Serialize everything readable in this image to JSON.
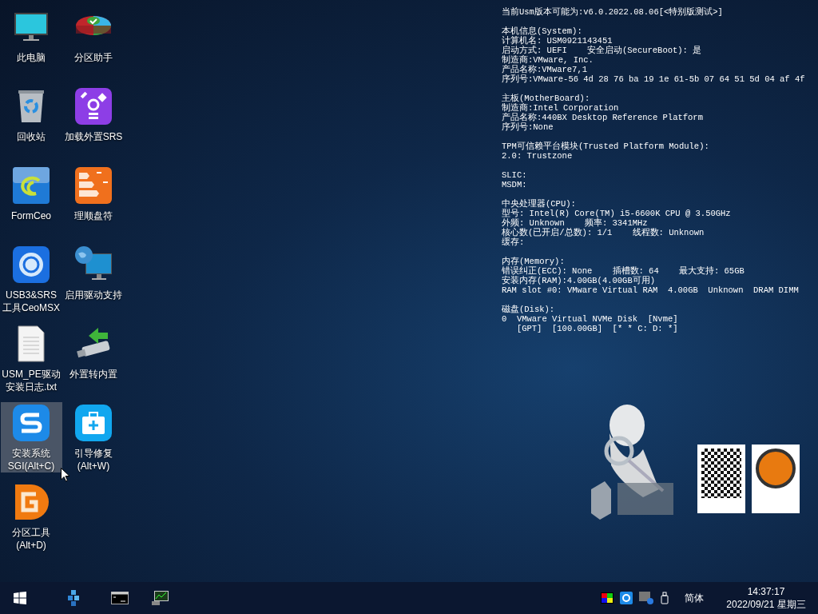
{
  "desktop_icons": [
    {
      "label": [
        "此电脑"
      ],
      "selected": false
    },
    {
      "label": [
        "分区助手"
      ],
      "selected": false
    },
    {
      "label": [
        "回收站"
      ],
      "selected": false
    },
    {
      "label": [
        "加载外置SRS"
      ],
      "selected": false
    },
    {
      "label": [
        "FormCeo"
      ],
      "selected": false
    },
    {
      "label": [
        "理顺盘符"
      ],
      "selected": false
    },
    {
      "label": [
        "USB3&SRS",
        "工具CeoMSX"
      ],
      "selected": false
    },
    {
      "label": [
        "启用驱动支持"
      ],
      "selected": false
    },
    {
      "label": [
        "USM_PE驱动",
        "安装日志.txt"
      ],
      "selected": false
    },
    {
      "label": [
        "外置转内置"
      ],
      "selected": false
    },
    {
      "label": [
        "安装系统",
        "SGI(Alt+C)"
      ],
      "selected": true
    },
    {
      "label": [
        "引导修复",
        "(Alt+W)"
      ],
      "selected": false
    },
    {
      "label": [
        "分区工具",
        "(Alt+D)"
      ],
      "selected": false
    }
  ],
  "system_info": [
    [
      "当前Usm版本可能为:v6.0.2022.08.06[<特别版测试>]"
    ],
    [
      "本机信息(System):",
      "计算机名: USM0921143451",
      "启动方式: UEFI    安全启动(SecureBoot): 是",
      "制造商:VMware, Inc.",
      "产品名称:VMware7,1",
      "序列号:VMware-56 4d 28 76 ba 19 1e 61-5b 07 64 51 5d 04 af 4f"
    ],
    [
      "主板(MotherBoard):",
      "制造商:Intel Corporation",
      "产品名称:440BX Desktop Reference Platform",
      "序列号:None"
    ],
    [
      "TPM可信赖平台模块(Trusted Platform Module):",
      "2.0: Trustzone"
    ],
    [
      "SLIC:",
      "MSDM:"
    ],
    [
      "中央处理器(CPU):",
      "型号: Intel(R) Core(TM) i5-6600K CPU @ 3.50GHz",
      "外频: Unknown    频率: 3341MHz",
      "核心数(已开启/总数): 1/1    线程数: Unknown",
      "缓存:"
    ],
    [
      "内存(Memory):",
      "错误纠正(ECC): None    插槽数: 64    最大支持: 65GB",
      "安装内存(RAM):4.00GB(4.00GB可用)",
      "RAM slot #0: VMware Virtual RAM  4.00GB  Unknown  DRAM DIMM"
    ],
    [
      "磁盘(Disk):",
      "0  VMware Virtual NVMe Disk  [Nvme]",
      "   [GPT]  [100.00GB]  [* * C: D: *]"
    ]
  ],
  "taskbar": {
    "language": "简体",
    "time": "14:37:17",
    "date": "2022/09/21 星期三"
  }
}
